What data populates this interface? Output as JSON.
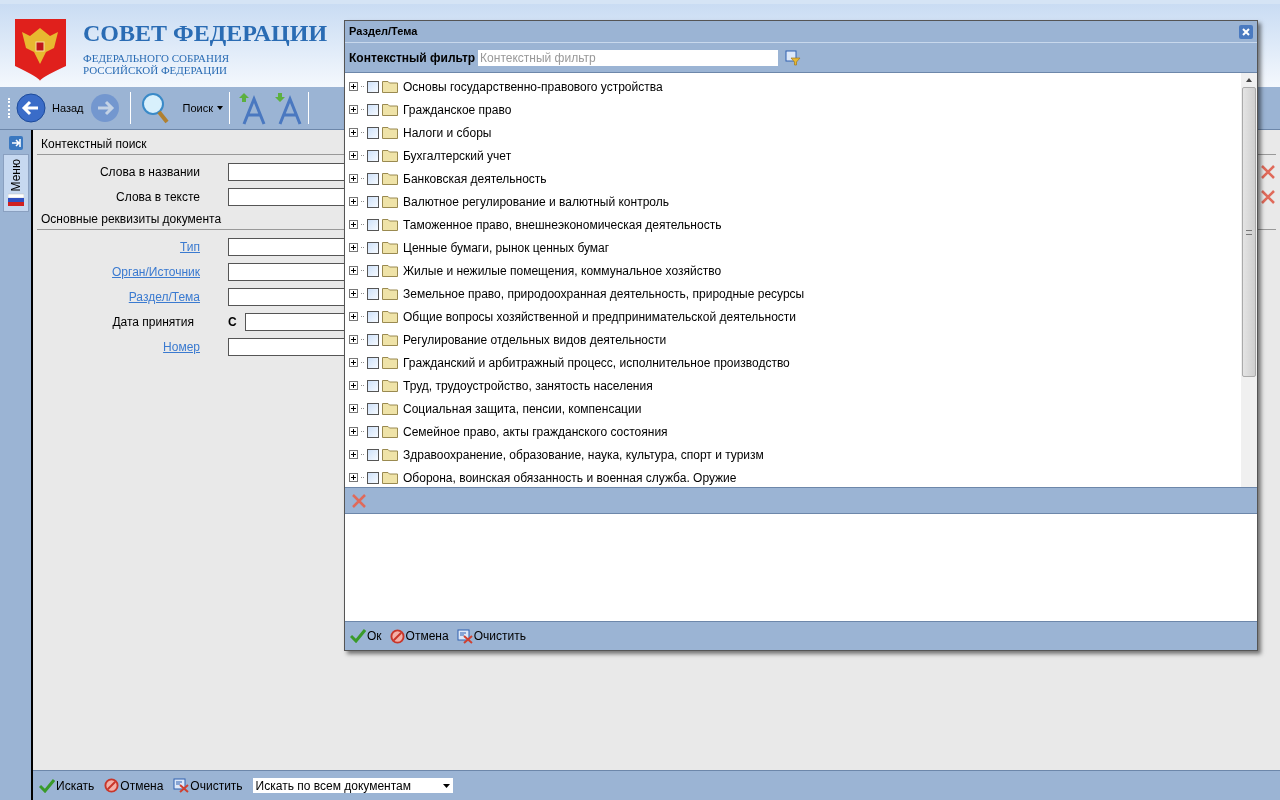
{
  "header": {
    "title": "СОВЕТ ФЕДЕРАЦИИ",
    "subtitle_lines": [
      "ФЕДЕРАЛЬНОГО СОБРАНИЯ",
      "РОССИЙСКОЙ ФЕДЕРАЦИИ"
    ]
  },
  "toolbar": {
    "back_label": "Назад",
    "forward_disabled": true,
    "search_label": "Поиск"
  },
  "sidebar": {
    "tab_label": "Меню"
  },
  "form": {
    "sections": [
      {
        "title": "Контекстный поиск",
        "fields": [
          {
            "label": "Слова в названии",
            "kind": "text",
            "link": false
          },
          {
            "label": "Слова в тексте",
            "kind": "text",
            "link": false
          }
        ]
      },
      {
        "title": "Основные реквизиты документа",
        "fields": [
          {
            "label": "Тип",
            "kind": "text",
            "link": true
          },
          {
            "label": "Орган/Источник",
            "kind": "text",
            "link": true
          },
          {
            "label": "Раздел/Тема",
            "kind": "text",
            "link": true
          },
          {
            "label": "Дата принятия",
            "kind": "date",
            "link": false,
            "prefix": "С"
          },
          {
            "label": "Номер",
            "kind": "text",
            "link": true
          }
        ]
      }
    ]
  },
  "bottom_bar": {
    "buttons": [
      {
        "kind": "ok",
        "label": "Искать"
      },
      {
        "kind": "cancel",
        "label": "Отмена"
      },
      {
        "kind": "clear",
        "label": "Очистить"
      }
    ],
    "scope_select": "Искать по всем документам"
  },
  "dialog": {
    "title": "Раздел/Тема",
    "filter_label": "Контекстный фильтр",
    "filter_placeholder": "Контекстный фильтр",
    "tree": [
      {
        "label": "Основы государственно-правового устройства",
        "checked": false,
        "expanded": false
      },
      {
        "label": "Гражданское право",
        "checked": false,
        "expanded": false
      },
      {
        "label": "Налоги и сборы",
        "checked": false,
        "expanded": false
      },
      {
        "label": "Бухгалтерский учет",
        "checked": false,
        "expanded": false
      },
      {
        "label": "Банковская деятельность",
        "checked": false,
        "expanded": false
      },
      {
        "label": "Валютное регулирование и валютный контроль",
        "checked": false,
        "expanded": false
      },
      {
        "label": "Таможенное право, внешнеэкономическая деятельность",
        "checked": false,
        "expanded": false
      },
      {
        "label": "Ценные бумаги, рынок ценных бумаг",
        "checked": false,
        "expanded": false
      },
      {
        "label": "Жилые и нежилые помещения, коммунальное хозяйство",
        "checked": false,
        "expanded": false
      },
      {
        "label": "Земельное право, природоохранная деятельность, природные ресурсы",
        "checked": false,
        "expanded": false
      },
      {
        "label": "Общие вопросы хозяйственной и предпринимательской деятельности",
        "checked": false,
        "expanded": false
      },
      {
        "label": "Регулирование отдельных видов деятельности",
        "checked": false,
        "expanded": false
      },
      {
        "label": "Гражданский и арбитражный процесс, исполнительное производство",
        "checked": false,
        "expanded": false
      },
      {
        "label": "Труд, трудоустройство, занятость населения",
        "checked": false,
        "expanded": false
      },
      {
        "label": "Социальная защита, пенсии, компенсации",
        "checked": false,
        "expanded": false
      },
      {
        "label": "Семейное право, акты гражданского состояния",
        "checked": false,
        "expanded": false
      },
      {
        "label": "Здравоохранение, образование, наука, культура, спорт и туризм",
        "checked": false,
        "expanded": false
      },
      {
        "label": "Оборона, воинская обязанность и военная служба. Оружие",
        "checked": false,
        "expanded": false
      }
    ],
    "buttons": [
      {
        "kind": "ok",
        "label": "Ок"
      },
      {
        "kind": "cancel",
        "label": "Отмена"
      },
      {
        "kind": "clear",
        "label": "Очистить"
      }
    ]
  }
}
